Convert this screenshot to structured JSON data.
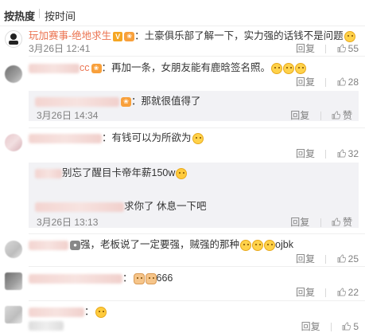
{
  "sort": {
    "hot": "按热度",
    "time": "按时间"
  },
  "actions": {
    "reply": "回复",
    "like": "赞"
  },
  "comments": [
    {
      "user": "玩加赛事-绝地求生",
      "text": "：土豪俱乐部了解一下，实力强的话钱不是问题",
      "time": "3月26日 12:41",
      "likes": "55"
    },
    {
      "user": "cc",
      "text": "：再加一条，女朋友能有鹿晗签名照。",
      "likes": "28",
      "reply": {
        "text": "：那就很值得了",
        "time": "3月26日 14:34"
      }
    },
    {
      "text": "：有钱可以为所欲为",
      "likes": "32",
      "reply": {
        "line1": "别忘了醒目卡帝年薪150w",
        "line2": "求你了 休息一下吧",
        "time": "3月26日 13:13"
      }
    },
    {
      "text": "强，老板说了一定要强，贼强的那种",
      "tail": "ojbk",
      "likes": "25"
    },
    {
      "text": "666",
      "likes": "22"
    },
    {
      "time": "",
      "likes": "5"
    }
  ]
}
